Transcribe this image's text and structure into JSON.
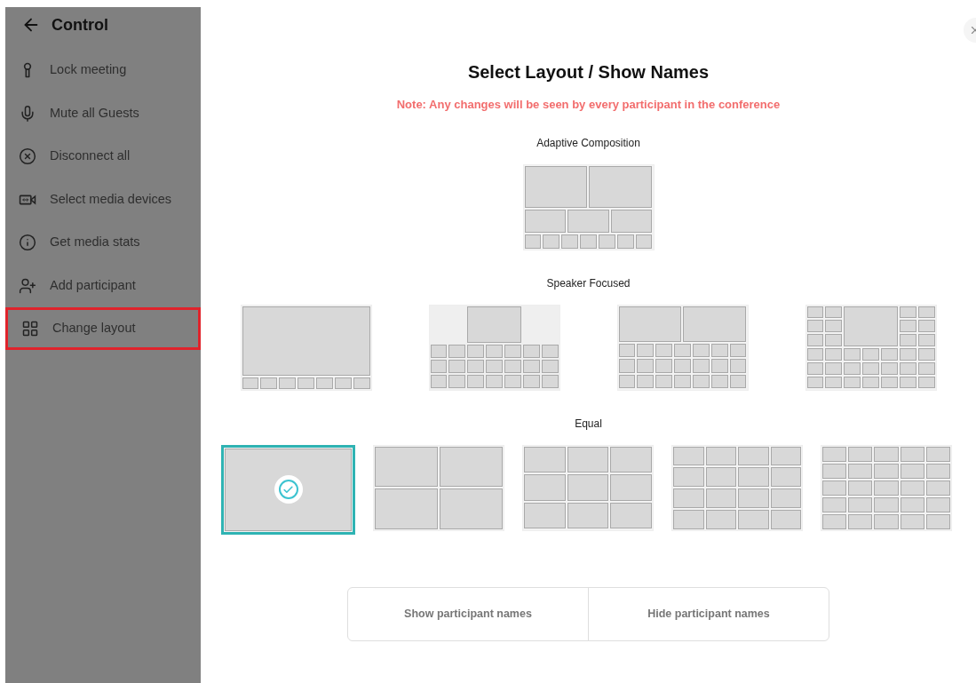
{
  "sidebar": {
    "title": "Control",
    "items": [
      {
        "label": "Lock meeting",
        "kind": "keyhole",
        "selected": false
      },
      {
        "label": "Mute all Guests",
        "kind": "mic",
        "selected": false
      },
      {
        "label": "Disconnect all",
        "kind": "circle-x",
        "selected": false
      },
      {
        "label": "Select media devices",
        "kind": "camera",
        "selected": false
      },
      {
        "label": "Get media stats",
        "kind": "info",
        "selected": false
      },
      {
        "label": "Add participant",
        "kind": "user-plus",
        "selected": false
      },
      {
        "label": "Change layout",
        "kind": "grid",
        "selected": true
      }
    ]
  },
  "dialog": {
    "title": "Select Layout / Show Names",
    "note": "Note: Any changes will be seen by every participant in the conference",
    "sections": [
      {
        "title": "Adaptive Composition",
        "layouts": [
          {
            "kind": "adaptive",
            "selected": false
          }
        ]
      },
      {
        "title": "Speaker Focused",
        "layouts": [
          {
            "kind": "speaker-full",
            "selected": false
          },
          {
            "kind": "speaker-top",
            "selected": false
          },
          {
            "kind": "speaker-two",
            "selected": false
          },
          {
            "kind": "speaker-center",
            "selected": false
          }
        ]
      },
      {
        "title": "Equal",
        "layouts": [
          {
            "kind": "grid-1",
            "selected": true
          },
          {
            "kind": "grid-2",
            "selected": false
          },
          {
            "kind": "grid-3",
            "selected": false
          },
          {
            "kind": "grid-4",
            "selected": false
          },
          {
            "kind": "grid-5",
            "selected": false
          }
        ]
      }
    ],
    "buttons": [
      "Show participant names",
      "Hide participant names"
    ]
  }
}
